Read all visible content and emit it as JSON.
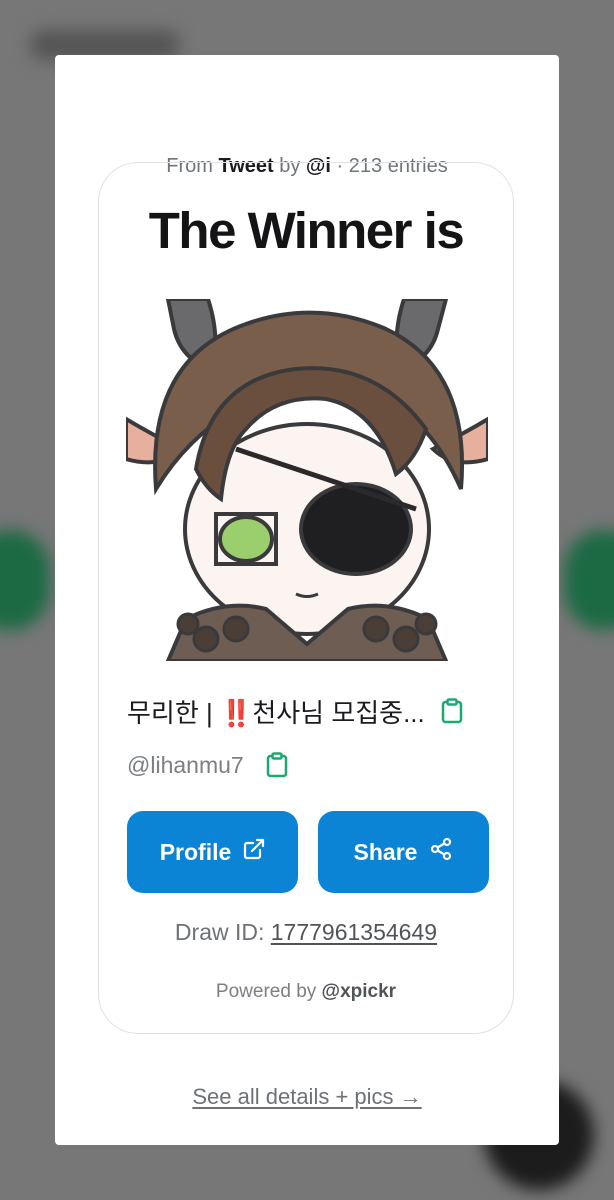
{
  "header": {
    "from_label": "From",
    "source_name": "Tweet",
    "by_label": "by",
    "author": "@i",
    "separator": "·",
    "entries": "213 entries"
  },
  "winner": {
    "title": "The Winner is",
    "display_name": "무리한 | ‼️천사님 모집중...",
    "handle": "@lihanmu7"
  },
  "buttons": {
    "profile_label": "Profile",
    "share_label": "Share"
  },
  "draw": {
    "label": "Draw ID:",
    "id": "1777961354649"
  },
  "footer": {
    "powered_label": "Powered by",
    "powered_brand": "@xpickr",
    "see_all": "See all details + pics →"
  },
  "colors": {
    "accent": "#0b84d6",
    "copy_icon": "#1aa970",
    "card_border": "#dfe2e6",
    "backdrop": "#777777"
  },
  "icons": {
    "copy": "clipboard-icon",
    "external": "external-link-icon",
    "share": "share-icon"
  }
}
